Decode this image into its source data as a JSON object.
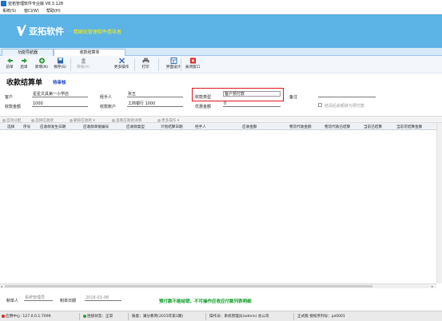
{
  "window": {
    "title": "亚拓管理软件专业版 V8.3.128"
  },
  "menu": [
    "系统(S)",
    "窗口(W)",
    "帮助(H)"
  ],
  "banner": {
    "logo": "亚拓软件",
    "tagline": "· 精细化管理软件倡导者",
    "color": "#5bb3e6",
    "tagline_color": "#fff200"
  },
  "tabs": [
    {
      "label": "功能导航器",
      "active": false
    },
    {
      "label": "收款结算单",
      "active": true
    }
  ],
  "toolbar": [
    {
      "label": "前单",
      "icon": "arrow-left-icon"
    },
    {
      "label": "后单",
      "icon": "arrow-right-icon"
    },
    {
      "label": "新增(N)",
      "icon": "add-icon"
    },
    {
      "label": "保存(S)",
      "icon": "save-icon"
    },
    {
      "label": "审核(A)",
      "icon": "audit-icon"
    },
    {
      "label": "更多操作",
      "icon": "more-icon"
    },
    {
      "label": "打印",
      "icon": "print-icon"
    },
    {
      "label": "界面设计",
      "icon": "design-icon"
    },
    {
      "label": "关闭窗口",
      "icon": "close-icon"
    }
  ],
  "form": {
    "title": "收款结算单",
    "status": "待审核",
    "customer_label": "客户",
    "customer": "星星文具第一小学店",
    "handler_label": "经手人",
    "handler": "张五",
    "type_label": "收款类型",
    "type": "客户预付款",
    "note_label": "备注",
    "note": "",
    "amount_label": "收款金额",
    "amount": "1000",
    "account_label": "收款账户",
    "account": "工商银行 1000",
    "discount_label": "优惠金额",
    "discount": "0",
    "checkbox_label": "结清后余额转为预付款"
  },
  "grid_tools": [
    "自动分配",
    "选择应收款",
    "删除应收款",
    "查看应收款详情",
    "更多操作"
  ],
  "grid_columns": [
    "选择",
    "序号",
    "应收款发生日期",
    "应收款单据编号",
    "应收款类型",
    "计划结算日期",
    "经手人",
    "应收金额",
    "物流代收金额",
    "物流代收已结算",
    "当前已结算",
    "当前可结算金额"
  ],
  "footer": {
    "creator_label": "制单人",
    "creator": "系统管理员",
    "date_label": "制单日期",
    "date": "2016-01-08",
    "notice": "预付款不能结销，不可操作应收应付款列表明细",
    "notice_color": "#0a9b24"
  },
  "statusbar": {
    "app": "应用中心: 127.0.0.1:7099",
    "connection": "连接状态：正常",
    "account_set": "账套：满分教育(2015年第1期)",
    "operator": "操作员：系统管理员(admin) 总公司",
    "license": "正式版  授权序列号：pz0001"
  }
}
